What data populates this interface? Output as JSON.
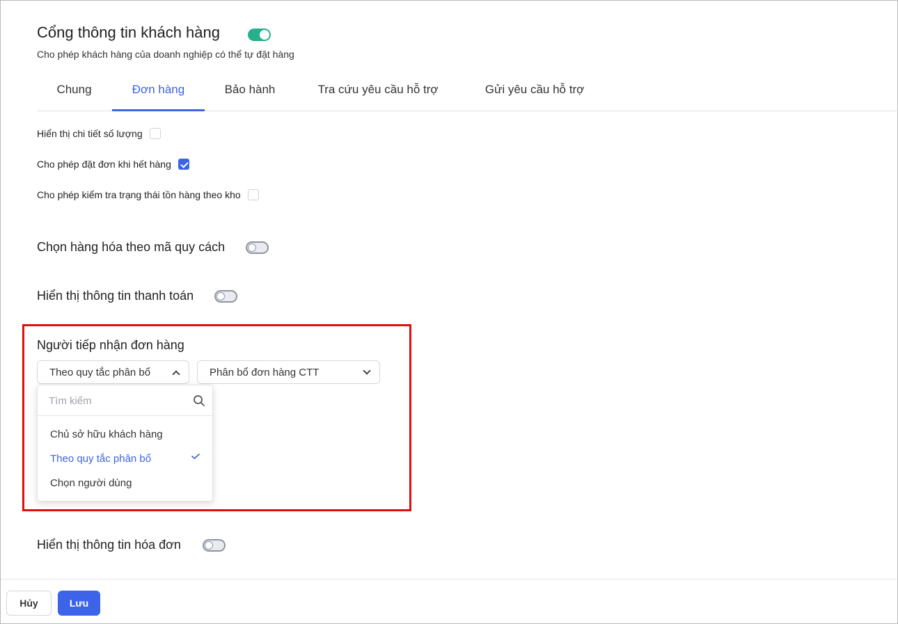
{
  "header": {
    "title": "Cổng thông tin khách hàng",
    "subtitle": "Cho phép khách hàng của doanh nghiệp có thể tự đặt hàng",
    "enabled": true
  },
  "tabs": [
    {
      "label": "Chung",
      "active": false
    },
    {
      "label": "Đơn hàng",
      "active": true
    },
    {
      "label": "Bảo hành",
      "active": false
    },
    {
      "label": "Tra cứu yêu cầu hỗ trợ",
      "active": false
    },
    {
      "label": "Gửi yêu cầu hỗ trợ",
      "active": false
    }
  ],
  "checkboxes": [
    {
      "label": "Hiển thị chi tiết số lượng",
      "checked": false
    },
    {
      "label": "Cho phép đặt đơn khi hết hàng",
      "checked": true
    },
    {
      "label": "Cho phép kiểm tra trạng thái tồn hàng theo kho",
      "checked": false
    }
  ],
  "toggles": [
    {
      "label": "Chọn hàng hóa theo mã quy cách",
      "on": false
    },
    {
      "label": "Hiển thị thông tin thanh toán",
      "on": false
    },
    {
      "label": "Hiển thị thông tin hóa đơn",
      "on": false
    }
  ],
  "receiver": {
    "heading": "Người tiếp nhận đơn hàng",
    "primary_select": "Theo quy tắc phân bổ",
    "secondary_select": "Phân bổ đơn hàng CTT",
    "search_placeholder": "Tìm kiếm",
    "options": [
      {
        "label": "Chủ sở hữu khách hàng",
        "selected": false
      },
      {
        "label": "Theo quy tắc phân bổ",
        "selected": true
      },
      {
        "label": "Chọn người dùng",
        "selected": false
      }
    ]
  },
  "footer": {
    "cancel_label": "Hủy",
    "save_label": "Lưu"
  },
  "colors": {
    "accent": "#3d63e8",
    "toggle_on": "#27b08a",
    "highlight": "#e30b0b"
  }
}
